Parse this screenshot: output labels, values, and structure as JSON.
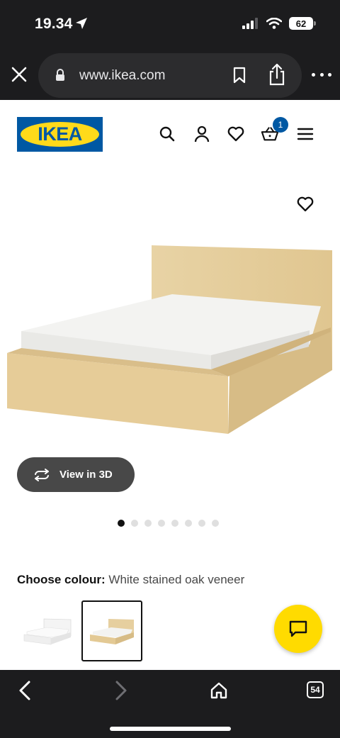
{
  "status": {
    "time": "19.34",
    "battery": "62"
  },
  "browser": {
    "url": "www.ikea.com",
    "tabs_count": "54"
  },
  "header": {
    "logo_text": "IKEA",
    "cart_count": "1"
  },
  "product": {
    "view_3d_label": "View in 3D",
    "image_count": 8,
    "active_image_index": 0,
    "colour_label": "Choose colour:",
    "colour_value": "White stained oak veneer",
    "swatches": [
      "white",
      "white stained oak veneer"
    ],
    "selected_swatch_index": 1
  },
  "colors": {
    "ikea_blue": "#0058a3",
    "ikea_yellow": "#ffda1a",
    "chat_yellow": "#ffdb00",
    "chrome": "#1c1c1e"
  }
}
